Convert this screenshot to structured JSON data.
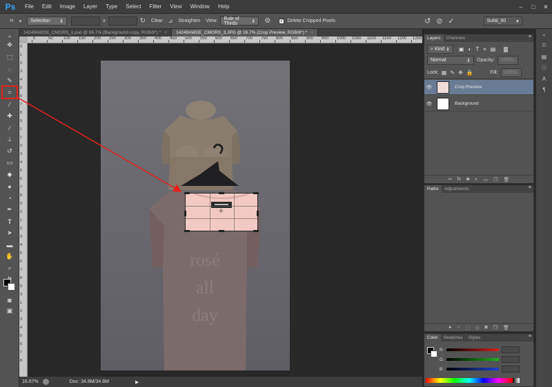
{
  "app": {
    "logo": "Ps"
  },
  "menu": [
    "File",
    "Edit",
    "Image",
    "Layer",
    "Type",
    "Select",
    "Filter",
    "View",
    "Window",
    "Help"
  ],
  "window_controls": [
    "–",
    "□",
    "✕"
  ],
  "options": {
    "mode": "Selection",
    "ratio_sep": "x",
    "clear": "Clear",
    "straighten": "Straighten",
    "view_label": "View:",
    "view_value": "Rule of Thirds",
    "delete_cropped": "Delete Cropped Pixels",
    "workspace": "Sufal_00"
  },
  "tabs": [
    {
      "title": "14249AWDE_CMORS_1.psd @ 66.7% (Background copy, RGB/8*) *",
      "active": false
    },
    {
      "title": "14249AWDE_CMORS_3.JPG @ 16.7% (Crop Preview, RGB/8*) *",
      "active": true
    }
  ],
  "ruler_top": [
    "0",
    "50",
    "100",
    "150",
    "200",
    "250",
    "300",
    "350",
    "400",
    "450",
    "500",
    "550",
    "600",
    "650",
    "700",
    "750",
    "800",
    "850",
    "900",
    "950",
    "1000",
    "1050",
    "1100",
    "1150",
    "1200",
    "1250"
  ],
  "ruler_left": [
    "0",
    "1",
    "2",
    "3",
    "4",
    "5",
    "6",
    "7",
    "8",
    "9",
    "1",
    "1",
    "2",
    "3",
    "4",
    "5",
    "6",
    "7",
    "8",
    "9",
    "2",
    "1",
    "2",
    "3",
    "4",
    "5",
    "6",
    "7",
    "8",
    "9",
    "3",
    "1",
    "2",
    "3",
    "4",
    "5",
    "6",
    "7",
    "8"
  ],
  "tshirt_text": [
    "rosé",
    "all",
    "day"
  ],
  "status": {
    "zoom": "16.67%",
    "doc": "Doc: 34.8M/34.8M"
  },
  "layers_panel": {
    "tabs": [
      "Layers",
      "Channels"
    ],
    "kind": "Kind",
    "blend": "Normal",
    "opacity_label": "Opacity:",
    "opacity_value": "100%",
    "lock_label": "Lock:",
    "fill_label": "Fill:",
    "fill_value": "100%",
    "layers": [
      {
        "name": "Crop Preview",
        "selected": true
      },
      {
        "name": "Background",
        "selected": false
      }
    ],
    "footer_icons": [
      "link-icon",
      "fx-icon",
      "mask-icon",
      "adjustment-icon",
      "folder-icon",
      "new-layer-icon",
      "trash-icon"
    ]
  },
  "paths_panel": {
    "tabs": [
      "Paths",
      "Adjustments"
    ]
  },
  "color_panel": {
    "tabs": [
      "Color",
      "Swatches",
      "Styles"
    ],
    "channels": [
      {
        "label": "R",
        "color": "#d62020"
      },
      {
        "label": "G",
        "color": "#20b020"
      },
      {
        "label": "B",
        "color": "#2040d0"
      }
    ]
  }
}
